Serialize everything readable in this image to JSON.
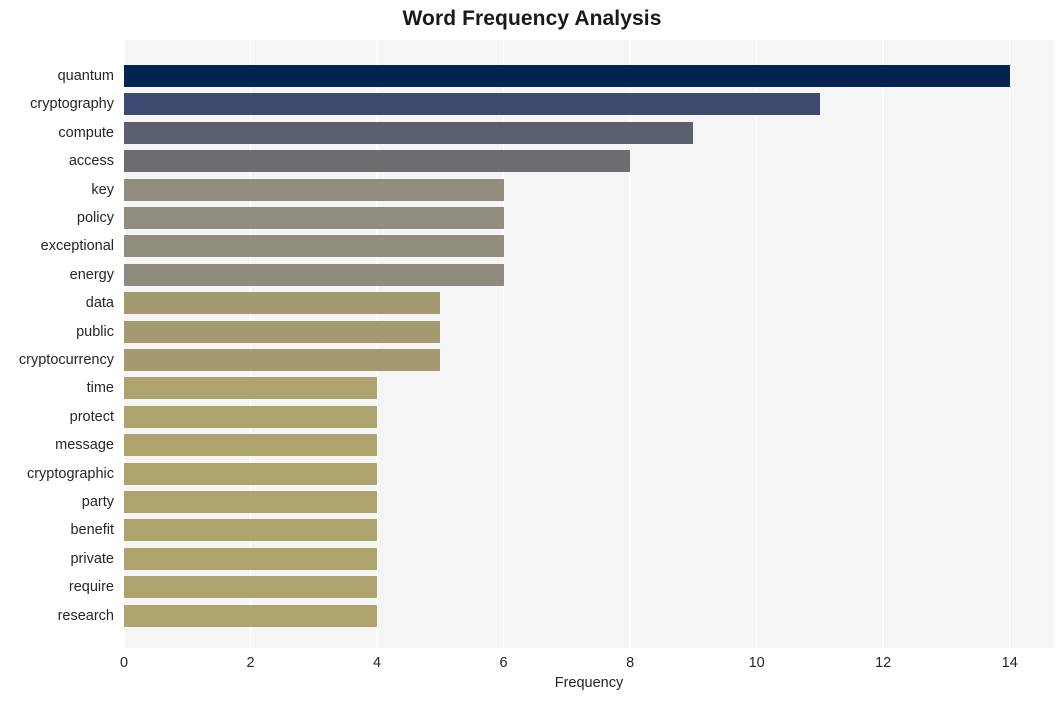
{
  "chart_data": {
    "type": "bar",
    "orientation": "horizontal",
    "title": "Word Frequency Analysis",
    "xlabel": "Frequency",
    "ylabel": "",
    "xlim": [
      0,
      14.7
    ],
    "xticks": [
      0,
      2,
      4,
      6,
      8,
      10,
      12,
      14
    ],
    "xticklabels": [
      "0",
      "2",
      "4",
      "6",
      "8",
      "10",
      "12",
      "14"
    ],
    "grid": "vertical-only",
    "legend": "none",
    "categories": [
      "quantum",
      "cryptography",
      "compute",
      "access",
      "key",
      "policy",
      "exceptional",
      "energy",
      "data",
      "public",
      "cryptocurrency",
      "time",
      "protect",
      "message",
      "cryptographic",
      "party",
      "benefit",
      "private",
      "require",
      "research"
    ],
    "values": [
      14,
      11,
      9,
      8,
      6,
      6,
      6,
      6,
      5,
      5,
      5,
      4,
      4,
      4,
      4,
      4,
      4,
      4,
      4,
      4
    ],
    "bar_colors": [
      "#032450",
      "#3c4a70",
      "#5b6070",
      "#6b6d71",
      "#918d7c",
      "#918d7e",
      "#918d7c",
      "#8e8b7e",
      "#a49a71",
      "#a39a72",
      "#a39a72",
      "#ada36c",
      "#ada36c",
      "#ada36c",
      "#ada36c",
      "#ada36c",
      "#ada36c",
      "#ada36c",
      "#ada36c",
      "#ada36c"
    ]
  },
  "style": {
    "figure_background": "#ffffff",
    "plot_background": "#f5f5f5",
    "gridline_color": "#ffffff",
    "text_color": "#262626"
  }
}
